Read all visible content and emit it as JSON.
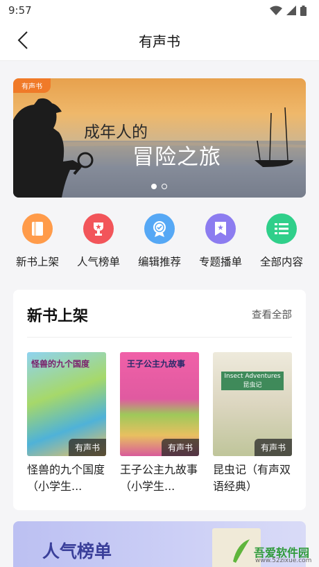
{
  "status_bar": {
    "time": "9:57"
  },
  "nav": {
    "title": "有声书"
  },
  "banner": {
    "tag": "有声书",
    "line1": "成年人的",
    "line2": "冒险之旅",
    "slide_index": 1,
    "slide_count": 2
  },
  "quick_links": [
    {
      "label": "新书上架",
      "icon": "book-icon",
      "color": "#ff9b4a"
    },
    {
      "label": "人气榜单",
      "icon": "trophy-icon",
      "color": "#f2555a"
    },
    {
      "label": "编辑推荐",
      "icon": "medal-icon",
      "color": "#56a8f5"
    },
    {
      "label": "专题播单",
      "icon": "bookmark-star-icon",
      "color": "#8c7cf0"
    },
    {
      "label": "全部内容",
      "icon": "list-icon",
      "color": "#2fcf8a"
    }
  ],
  "new_books": {
    "title": "新书上架",
    "more": "查看全部",
    "badge": "有声书",
    "items": [
      {
        "title": "怪兽的九个国度（小学生...",
        "cover_text": "怪兽的九个国度"
      },
      {
        "title": "王子公主九故事（小学生...",
        "cover_text": "王子公主九故事"
      },
      {
        "title": "昆虫记（有声双语经典）",
        "cover_text": "Insect Adventures 昆虫记"
      }
    ]
  },
  "rank_section": {
    "title": "人气榜单"
  },
  "watermark": {
    "text": "吾爱软件园",
    "url": "www.52zixue.com"
  }
}
